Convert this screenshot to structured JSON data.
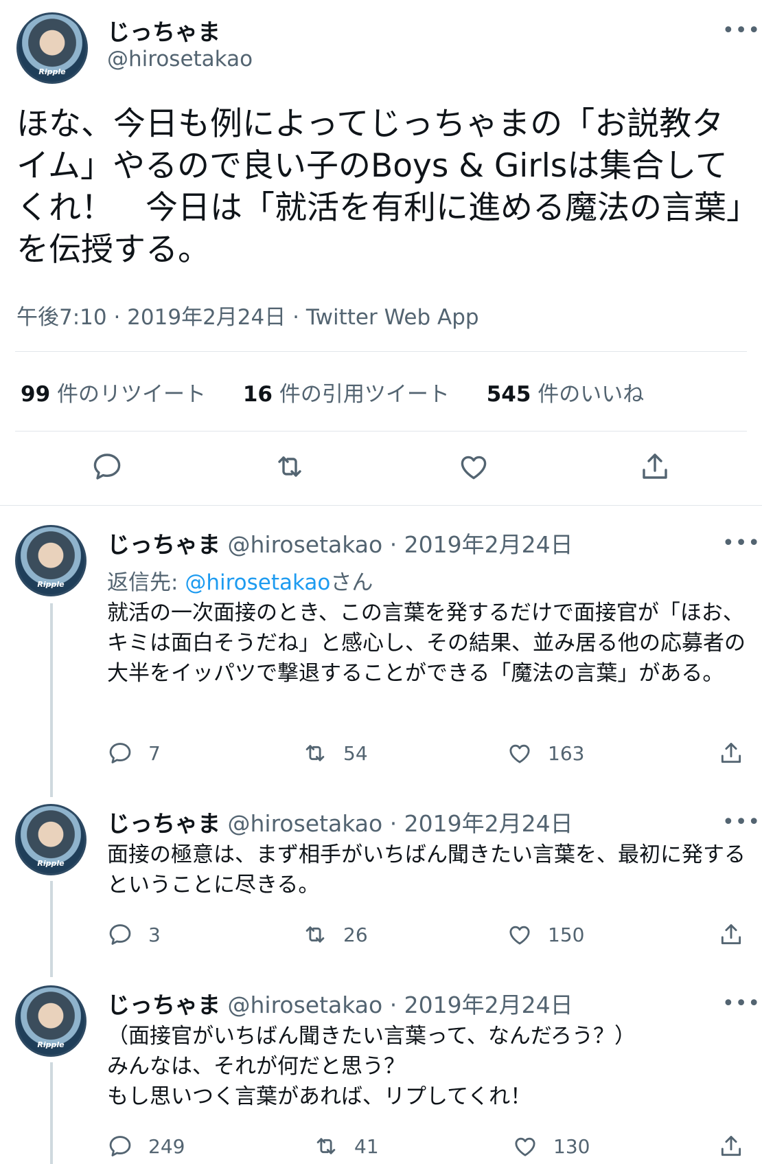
{
  "main": {
    "name": "じっちゃま",
    "handle": "@hirosetakao",
    "text": "ほな、今日も例によってじっちゃまの「お説教タイム」やるので良い子のBoys & Girlsは集合してくれ！　今日は「就活を有利に進める魔法の言葉」を伝授する。",
    "time": "午後7:10 · 2019年2月24日 · ",
    "app": "Twitter Web App",
    "stats": [
      {
        "count": "99",
        "label": " 件のリツイート"
      },
      {
        "count": "16",
        "label": " 件の引用ツイート"
      },
      {
        "count": "545",
        "label": " 件のいいね"
      }
    ],
    "avatar_text": "Ripple"
  },
  "replies": [
    {
      "name": "じっちゃま",
      "meta": " @hirosetakao · 2019年2月24日",
      "reply_to_label": "返信先: ",
      "reply_to_mention": "@hirosetakao",
      "reply_to_suffix": "さん",
      "text": "就活の一次面接のとき、この言葉を発するだけで面接官が「ほお、キミは面白そうだね」と感心し、その結果、並み居る他の応募者の大半をイッパツで撃退することができる「魔法の言葉」がある。",
      "replies": "7",
      "retweets": "54",
      "likes": "163"
    },
    {
      "name": "じっちゃま",
      "meta": " @hirosetakao · 2019年2月24日",
      "text": "面接の極意は、まず相手がいちばん聞きたい言葉を、最初に発するということに尽きる。",
      "replies": "3",
      "retweets": "26",
      "likes": "150"
    },
    {
      "name": "じっちゃま",
      "meta": " @hirosetakao · 2019年2月24日",
      "text_lines": [
        "（面接官がいちばん聞きたい言葉って、なんだろう？）",
        "みんなは、それが何だと思う？",
        "もし思いつく言葉があれば、リプしてくれ！"
      ],
      "replies": "249",
      "retweets": "41",
      "likes": "130"
    }
  ],
  "more_label": "•••",
  "icons": [
    "reply-icon",
    "retweet-icon",
    "like-icon",
    "share-icon",
    "more-icon"
  ],
  "colors": {
    "text": "#0f1419",
    "secondary": "#536471",
    "link": "#1d9bf0",
    "divider": "#e1e6ea"
  }
}
